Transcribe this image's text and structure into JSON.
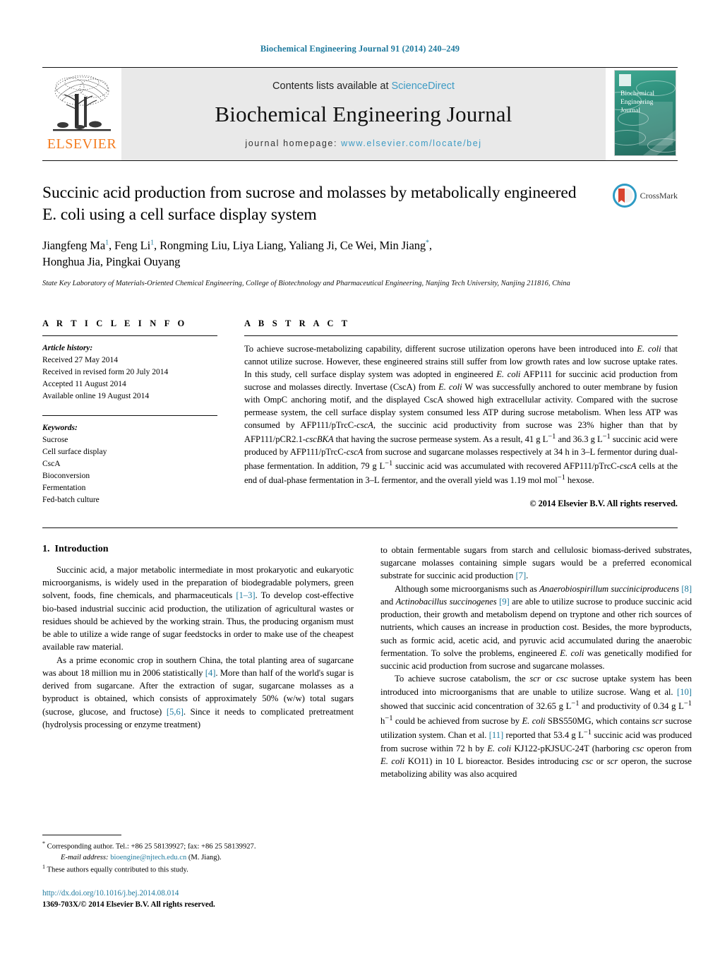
{
  "running_head": "Biochemical Engineering Journal 91 (2014) 240–249",
  "masthead": {
    "publisher": "ELSEVIER",
    "contents_prefix": "Contents lists available at ",
    "contents_link": "ScienceDirect",
    "journal_title": "Biochemical Engineering Journal",
    "homepage_prefix": "journal homepage:",
    "homepage_url": "www.elsevier.com/locate/bej",
    "cover_title_line1": "Biochemical",
    "cover_title_line2": "Engineering",
    "cover_title_line3": "Journal",
    "accent_link_color": "#3d9bc4",
    "cover_color": "#2e8f7c",
    "elsevier_orange": "#F47C20"
  },
  "article": {
    "title": "Succinic acid production from sucrose and molasses by metabolically engineered E. coli using a cell surface display system",
    "authors_line1_a": "Jiangfeng Ma",
    "authors_line1_sup1": "1",
    "authors_line1_b": ", Feng Li",
    "authors_line1_sup2": "1",
    "authors_line1_c": ", Rongming Liu, Liya Liang, Yaliang Ji, Ce Wei, Min Jiang",
    "authors_star": "*",
    "authors_line1_d": ",",
    "authors_line2": "Honghua Jia, Pingkai Ouyang",
    "affiliation": "State Key Laboratory of Materials-Oriented Chemical Engineering, College of Biotechnology and Pharmaceutical Engineering, Nanjing Tech University, Nanjing 211816, China",
    "crossmark_label": "CrossMark"
  },
  "article_info": {
    "heading": "A R T I C L E   I N F O",
    "history_label": "Article history:",
    "history": [
      "Received 27 May 2014",
      "Received in revised form 20 July 2014",
      "Accepted 11 August 2014",
      "Available online 19 August 2014"
    ],
    "keywords_label": "Keywords:",
    "keywords": [
      "Sucrose",
      "Cell surface display",
      "CscA",
      "Bioconversion",
      "Fermentation",
      "Fed-batch culture"
    ]
  },
  "abstract": {
    "heading": "A B S T R A C T",
    "paragraph_1": "To achieve sucrose-metabolizing capability, different sucrose utilization operons have been introduced into ",
    "organism_1": "E. coli",
    "paragraph_2": " that cannot utilize sucrose. However, these engineered strains still suffer from low growth rates and low sucrose uptake rates. In this study, cell surface display system was adopted in engineered ",
    "organism_2": "E. coli",
    "paragraph_3": " AFP111 for succinic acid production from sucrose and molasses directly. Invertase (CscA) from ",
    "organism_3": "E. coli",
    "paragraph_4": " W was successfully anchored to outer membrane by fusion with OmpC anchoring motif, and the displayed CscA showed high extracellular activity. Compared with the sucrose permease system, the cell surface display system consumed less ATP during sucrose metabolism. When less ATP was consumed by AFP111/pTrcC-",
    "gene_1": "cscA",
    "paragraph_5": ", the succinic acid productivity from sucrose was 23% higher than that by AFP111/pCR2.1-",
    "gene_2": "cscBKA",
    "paragraph_6": " that having the sucrose permease system. As a result, 41 g L",
    "sup_1": "−1",
    "paragraph_7": " and 36.3 g L",
    "sup_2": "−1",
    "paragraph_8": " succinic acid were produced by AFP111/pTrcC-",
    "gene_3": "cscA",
    "paragraph_9": " from sucrose and sugarcane molasses respectively at 34 h in 3–L fermentor during dual-phase fermentation. In addition, 79 g L",
    "sup_3": "−1",
    "paragraph_10": " succinic acid was accumulated with recovered AFP111/pTrcC-",
    "gene_4": "cscA",
    "paragraph_11": " cells at the end of dual-phase fermentation in 3–L fermentor, and the overall yield was 1.19 mol mol",
    "sup_4": "−1",
    "paragraph_12": " hexose.",
    "copyright": "© 2014 Elsevier B.V. All rights reserved."
  },
  "introduction": {
    "section_number": "1.",
    "section_title": "Introduction",
    "left_p1_a": "Succinic acid, a major metabolic intermediate in most prokaryotic and eukaryotic microorganisms, is widely used in the preparation of biodegradable polymers, green solvent, foods, fine chemicals, and pharmaceuticals ",
    "left_p1_ref": "[1–3]",
    "left_p1_b": ". To develop cost-effective bio-based industrial succinic acid production, the utilization of agricultural wastes or residues should be achieved by the working strain. Thus, the producing organism must be able to utilize a wide range of sugar feedstocks in order to make use of the cheapest available raw material.",
    "left_p2_a": "As a prime economic crop in southern China, the total planting area of sugarcane was about 18 million mu in 2006 statistically ",
    "left_p2_ref1": "[4]",
    "left_p2_b": ". More than half of the world's sugar is derived from sugarcane. After the extraction of sugar, sugarcane molasses as a byproduct is obtained, which consists of approximately 50% (w/w) total sugars (sucrose, glucose, and fructose) ",
    "left_p2_ref2": "[5,6]",
    "left_p2_c": ". Since it needs to complicated pretreatment (hydrolysis processing or enzyme treatment)",
    "right_p1_a": "to obtain fermentable sugars from starch and cellulosic biomass-derived substrates, sugarcane molasses containing simple sugars would be a preferred economical substrate for succinic acid production ",
    "right_p1_ref": "[7]",
    "right_p1_b": ".",
    "right_p2_a": "Although some microorganisms such as ",
    "right_p2_org1": "Anaerobiospirillum succiniciproducens",
    "right_p2_ref1": "[8]",
    "right_p2_b": " and ",
    "right_p2_org2": "Actinobacillus succinogenes",
    "right_p2_ref2": "[9]",
    "right_p2_c": " are able to utilize sucrose to produce succinic acid production, their growth and metabolism depend on tryptone and other rich sources of nutrients, which causes an increase in production cost. Besides, the more byproducts, such as formic acid, acetic acid, and pyruvic acid accumulated during the anaerobic fermentation. To solve the problems, engineered ",
    "right_p2_org3": "E. coli",
    "right_p2_d": " was genetically modified for succinic acid production from sucrose and sugarcane molasses.",
    "right_p3_a": "To achieve sucrose catabolism, the ",
    "right_p3_gene1": "scr",
    "right_p3_b": " or ",
    "right_p3_gene2": "csc",
    "right_p3_c": " sucrose uptake system has been introduced into microorganisms that are unable to utilize sucrose. Wang et al. ",
    "right_p3_ref1": "[10]",
    "right_p3_d": " showed that succinic acid concentration of 32.65 g L",
    "right_p3_sup1": "−1",
    "right_p3_e": " and productivity of 0.34 g L",
    "right_p3_sup2": "−1",
    "right_p3_f": " h",
    "right_p3_sup3": "−1",
    "right_p3_g": " could be achieved from sucrose by ",
    "right_p3_org1": "E. coli",
    "right_p3_h": " SBS550MG, which contains ",
    "right_p3_gene3": "scr",
    "right_p3_i": " sucrose utilization system. Chan et al. ",
    "right_p3_ref2": "[11]",
    "right_p3_j": " reported that 53.4 g L",
    "right_p3_sup4": "−1",
    "right_p3_k": " succinic acid was produced from sucrose within 72 h by ",
    "right_p3_org2": "E. coli",
    "right_p3_l": " KJ122-pKJSUC-24T (harboring ",
    "right_p3_gene4": "csc",
    "right_p3_m": " operon from ",
    "right_p3_org3": "E. coli",
    "right_p3_n": " KO11) in 10 L bioreactor. Besides introducing ",
    "right_p3_gene5": "csc",
    "right_p3_o": " or ",
    "right_p3_gene6": "scr",
    "right_p3_p": " operon, the sucrose metabolizing ability was also acquired"
  },
  "footnotes": {
    "corresponding_marker": "*",
    "corresponding_text": "Corresponding author. Tel.: +86 25 58139927; fax: +86 25 58139927.",
    "email_label": "E-mail address:",
    "email": "bioengine@njtech.edu.cn",
    "email_suffix": "(M. Jiang).",
    "equal_marker": "1",
    "equal_text": "These authors equally contributed to this study.",
    "doi": "http://dx.doi.org/10.1016/j.bej.2014.08.014",
    "issn_line": "1369-703X/© 2014 Elsevier B.V. All rights reserved."
  }
}
